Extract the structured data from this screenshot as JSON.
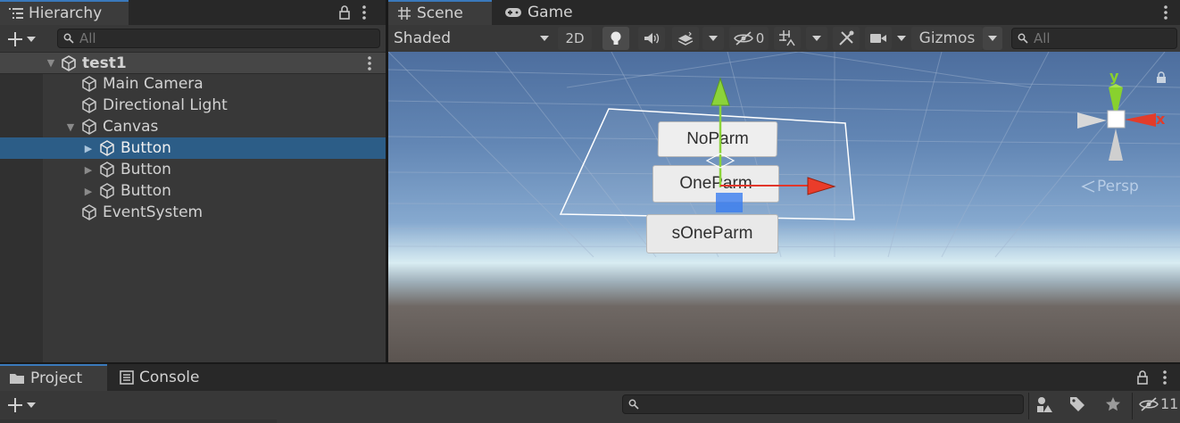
{
  "hierarchy": {
    "tab_label": "Hierarchy",
    "search_placeholder": "All",
    "scene_name": "test1",
    "items": [
      {
        "label": "Main Camera"
      },
      {
        "label": "Directional Light"
      },
      {
        "label": "Canvas"
      },
      {
        "label": "Button"
      },
      {
        "label": "Button"
      },
      {
        "label": "Button"
      },
      {
        "label": "EventSystem"
      }
    ]
  },
  "scene_view": {
    "tabs": [
      {
        "label": "Scene"
      },
      {
        "label": "Game"
      }
    ],
    "shading_mode": "Shaded",
    "mode_2d_label": "2D",
    "hidden_count": "0",
    "gizmos_label": "Gizmos",
    "search_placeholder": "All",
    "buttons": [
      {
        "label": "NoParm"
      },
      {
        "label": "OneParm"
      },
      {
        "label": "sOneParm"
      }
    ],
    "orientation": {
      "y_label": "y",
      "x_label": "x",
      "projection_label": "Persp"
    }
  },
  "bottom_panel": {
    "tabs": [
      {
        "label": "Project"
      },
      {
        "label": "Console"
      }
    ],
    "visibility_count": "11"
  },
  "colors": {
    "accent": "#3a79bb",
    "selected_row": "#2c5d87",
    "panel_bg": "#383838",
    "axis_x": "#e23c2a",
    "axis_y": "#88d12e"
  }
}
